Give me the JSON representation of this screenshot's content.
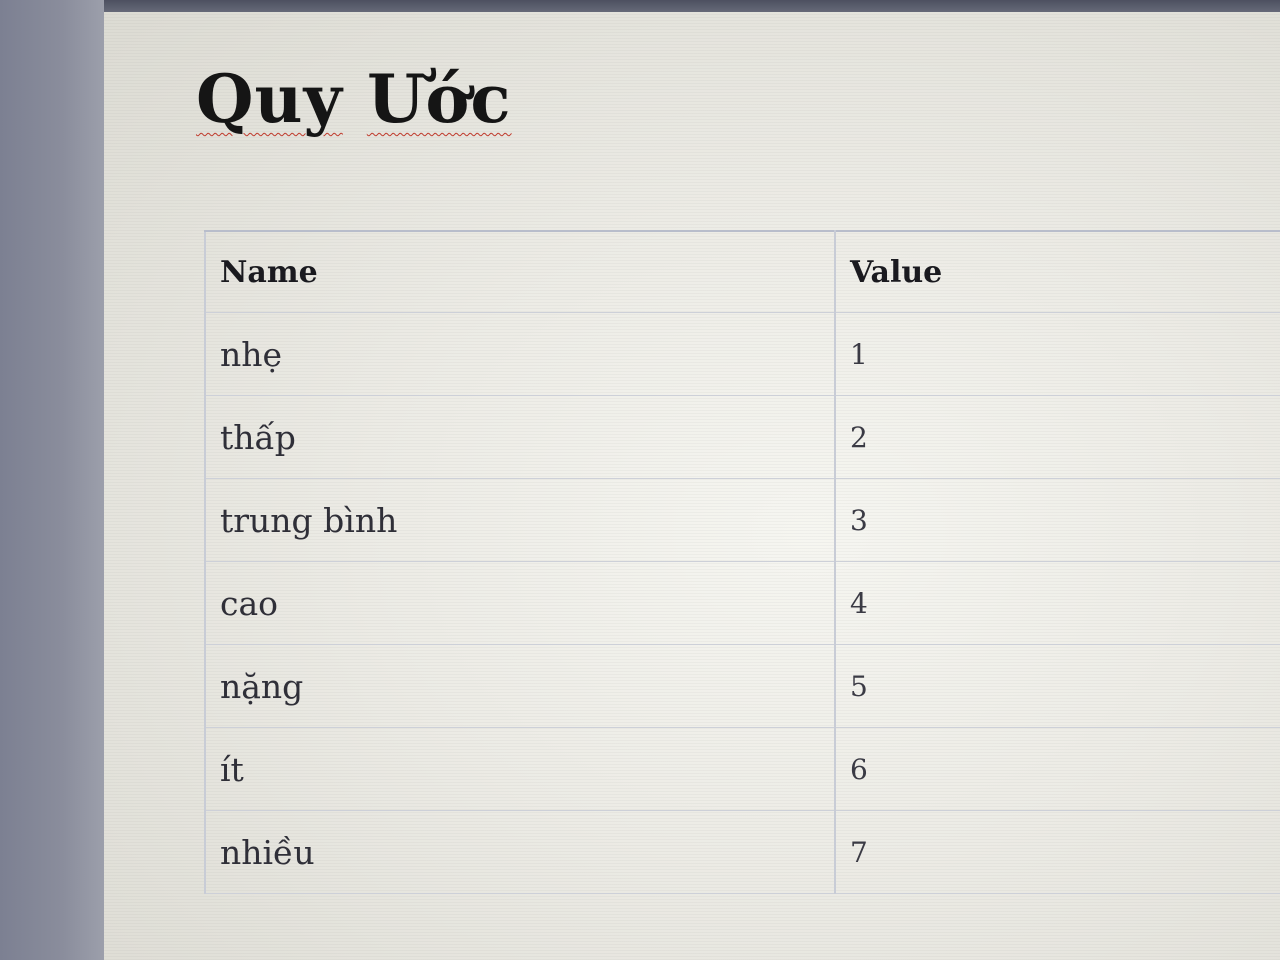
{
  "document": {
    "title_words": [
      "Quy",
      "Ước"
    ]
  },
  "table": {
    "headers": {
      "name": "Name",
      "value": "Value"
    },
    "rows": [
      {
        "name": "nhẹ",
        "value": "1"
      },
      {
        "name": "thấp",
        "value": "2"
      },
      {
        "name": "trung bình",
        "value": "3"
      },
      {
        "name": "cao",
        "value": "4"
      },
      {
        "name": "nặng",
        "value": "5"
      },
      {
        "name": "ít",
        "value": "6"
      },
      {
        "name": "nhiều",
        "value": "7"
      }
    ]
  },
  "colors": {
    "spellcheck_underline": "#c0392b",
    "title_text": "#151515",
    "table_border": "#c8ccd6"
  }
}
